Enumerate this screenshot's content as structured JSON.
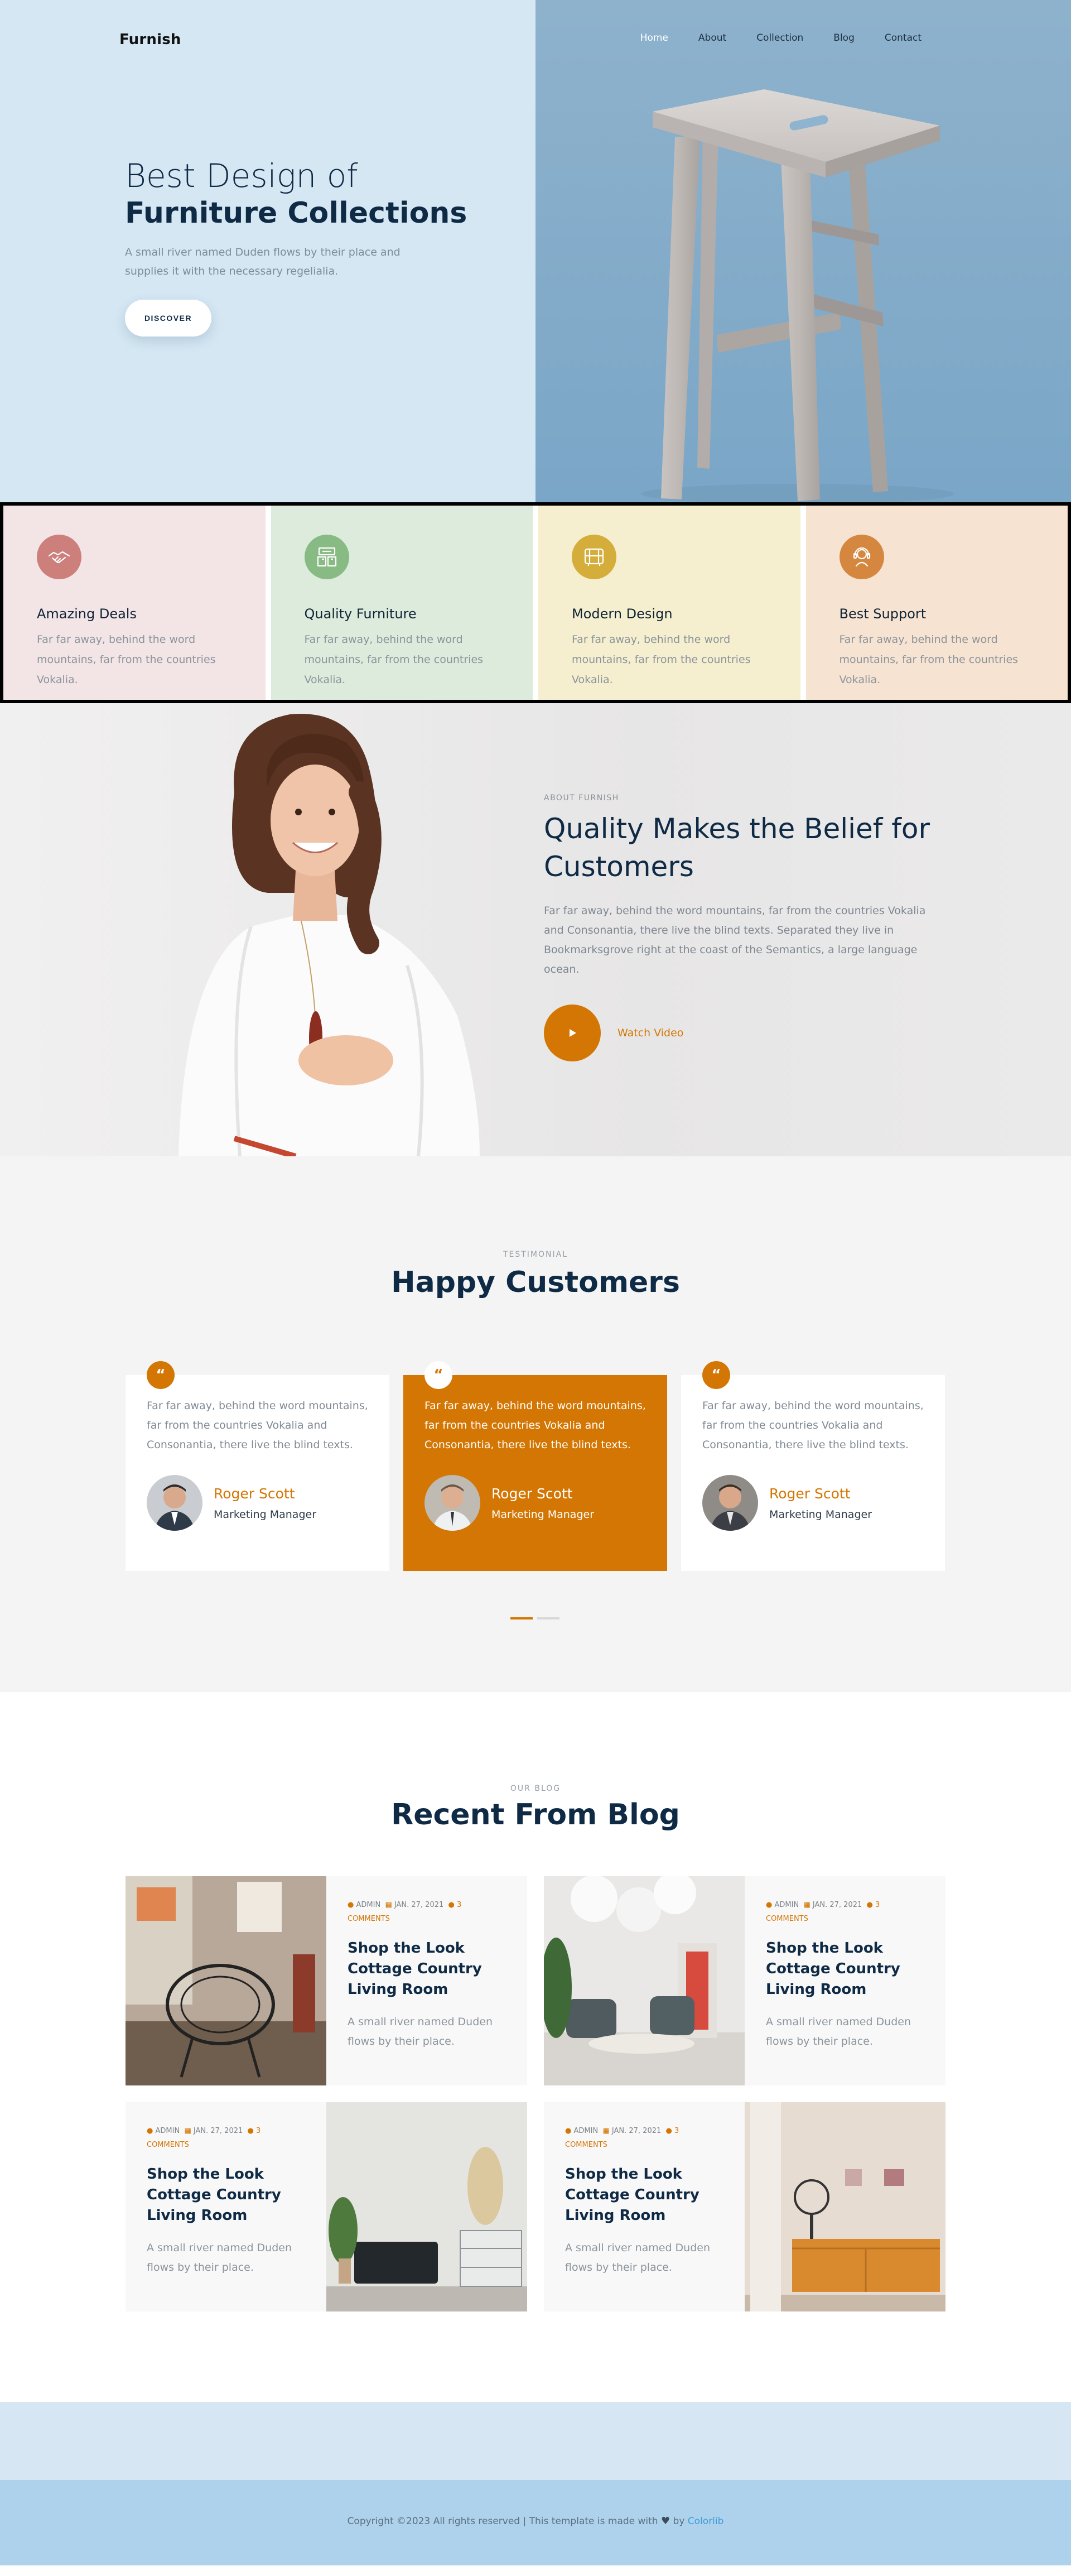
{
  "brand": "Furnish",
  "nav": {
    "items": [
      {
        "label": "Home",
        "active": true
      },
      {
        "label": "About",
        "active": false
      },
      {
        "label": "Collection",
        "active": false
      },
      {
        "label": "Blog",
        "active": false
      },
      {
        "label": "Contact",
        "active": false
      }
    ]
  },
  "hero": {
    "title_light": "Best Design of",
    "title_bold": "Furniture Collections",
    "description": "A small river named Duden flows by their place and supplies it with the necessary regelialia.",
    "cta": "DISCOVER",
    "image": "wooden-bar-stool-photo"
  },
  "features": [
    {
      "title": "Amazing Deals",
      "desc": "Far far away, behind the word mountains, far from the countries Vokalia.",
      "icon": "handshake-icon",
      "bg": "#f3e4e5",
      "icon_bg": "#cd7f7c"
    },
    {
      "title": "Quality Furniture",
      "desc": "Far far away, behind the word mountains, far from the countries Vokalia.",
      "icon": "furniture-boxes-icon",
      "bg": "#dcebdb",
      "icon_bg": "#88ba84"
    },
    {
      "title": "Modern Design",
      "desc": "Far far away, behind the word mountains, far from the countries Vokalia.",
      "icon": "design-tools-icon",
      "bg": "#f5efcf",
      "icon_bg": "#d4ad3b"
    },
    {
      "title": "Best Support",
      "desc": "Far far away, behind the word mountains, far from the countries Vokalia.",
      "icon": "support-agent-icon",
      "bg": "#f6e3d1",
      "icon_bg": "#d6873f"
    }
  ],
  "about": {
    "eyebrow": "ABOUT FURNISH",
    "title": "Quality Makes the Belief for Customers",
    "description": "Far far away, behind the word mountains, far from the countries Vokalia and Consonantia, there live the blind texts. Separated they live in Bookmarksgrove right at the coast of the Semantics, a large language ocean.",
    "video_label": "Watch Video"
  },
  "testimonial": {
    "eyebrow": "TESTIMONIAL",
    "title": "Happy Customers",
    "items": [
      {
        "quote": "Far far away, behind the word mountains, far from the countries Vokalia and Consonantia, there live the blind texts.",
        "name": "Roger Scott",
        "role": "Marketing Manager",
        "featured": false
      },
      {
        "quote": "Far far away, behind the word mountains, far from the countries Vokalia and Consonantia, there live the blind texts.",
        "name": "Roger Scott",
        "role": "Marketing Manager",
        "featured": true
      },
      {
        "quote": "Far far away, behind the word mountains, far from the countries Vokalia and Consonantia, there live the blind texts.",
        "name": "Roger Scott",
        "role": "Marketing Manager",
        "featured": false
      }
    ],
    "pager": {
      "count": 2,
      "active": 0
    }
  },
  "blog": {
    "eyebrow": "OUR BLOG",
    "title": "Recent From Blog",
    "posts": [
      {
        "author": "ADMIN",
        "date": "JAN. 27, 2021",
        "comments": "3",
        "comments_label": "COMMENTS",
        "title": "Shop the Look Cottage Country Living Room",
        "excerpt": "A small river named Duden flows by their place.",
        "image": "wicker-chair-room-photo"
      },
      {
        "author": "ADMIN",
        "date": "JAN. 27, 2021",
        "comments": "3",
        "comments_label": "COMMENTS",
        "title": "Shop the Look Cottage Country Living Room",
        "excerpt": "A small river named Duden flows by their place.",
        "image": "modern-lounge-photo"
      },
      {
        "author": "ADMIN",
        "date": "JAN. 27, 2021",
        "comments": "3",
        "comments_label": "COMMENTS",
        "title": "Shop the Look Cottage Country Living Room",
        "excerpt": "A small river named Duden flows by their place.",
        "image": "dark-sofa-photo"
      },
      {
        "author": "ADMIN",
        "date": "JAN. 27, 2021",
        "comments": "3",
        "comments_label": "COMMENTS",
        "title": "Shop the Look Cottage Country Living Room",
        "excerpt": "A small river named Duden flows by their place.",
        "image": "orange-cabinet-photo"
      }
    ]
  },
  "footer": {
    "copyright": "Copyright ©2023 All rights reserved | This template is made with",
    "by": "by",
    "credit": "Colorlib"
  },
  "colors": {
    "accent": "#d47603",
    "navy": "#0f2a45",
    "hero_bg": "#d5e7f3",
    "footer_bg": "#aed2ec"
  }
}
